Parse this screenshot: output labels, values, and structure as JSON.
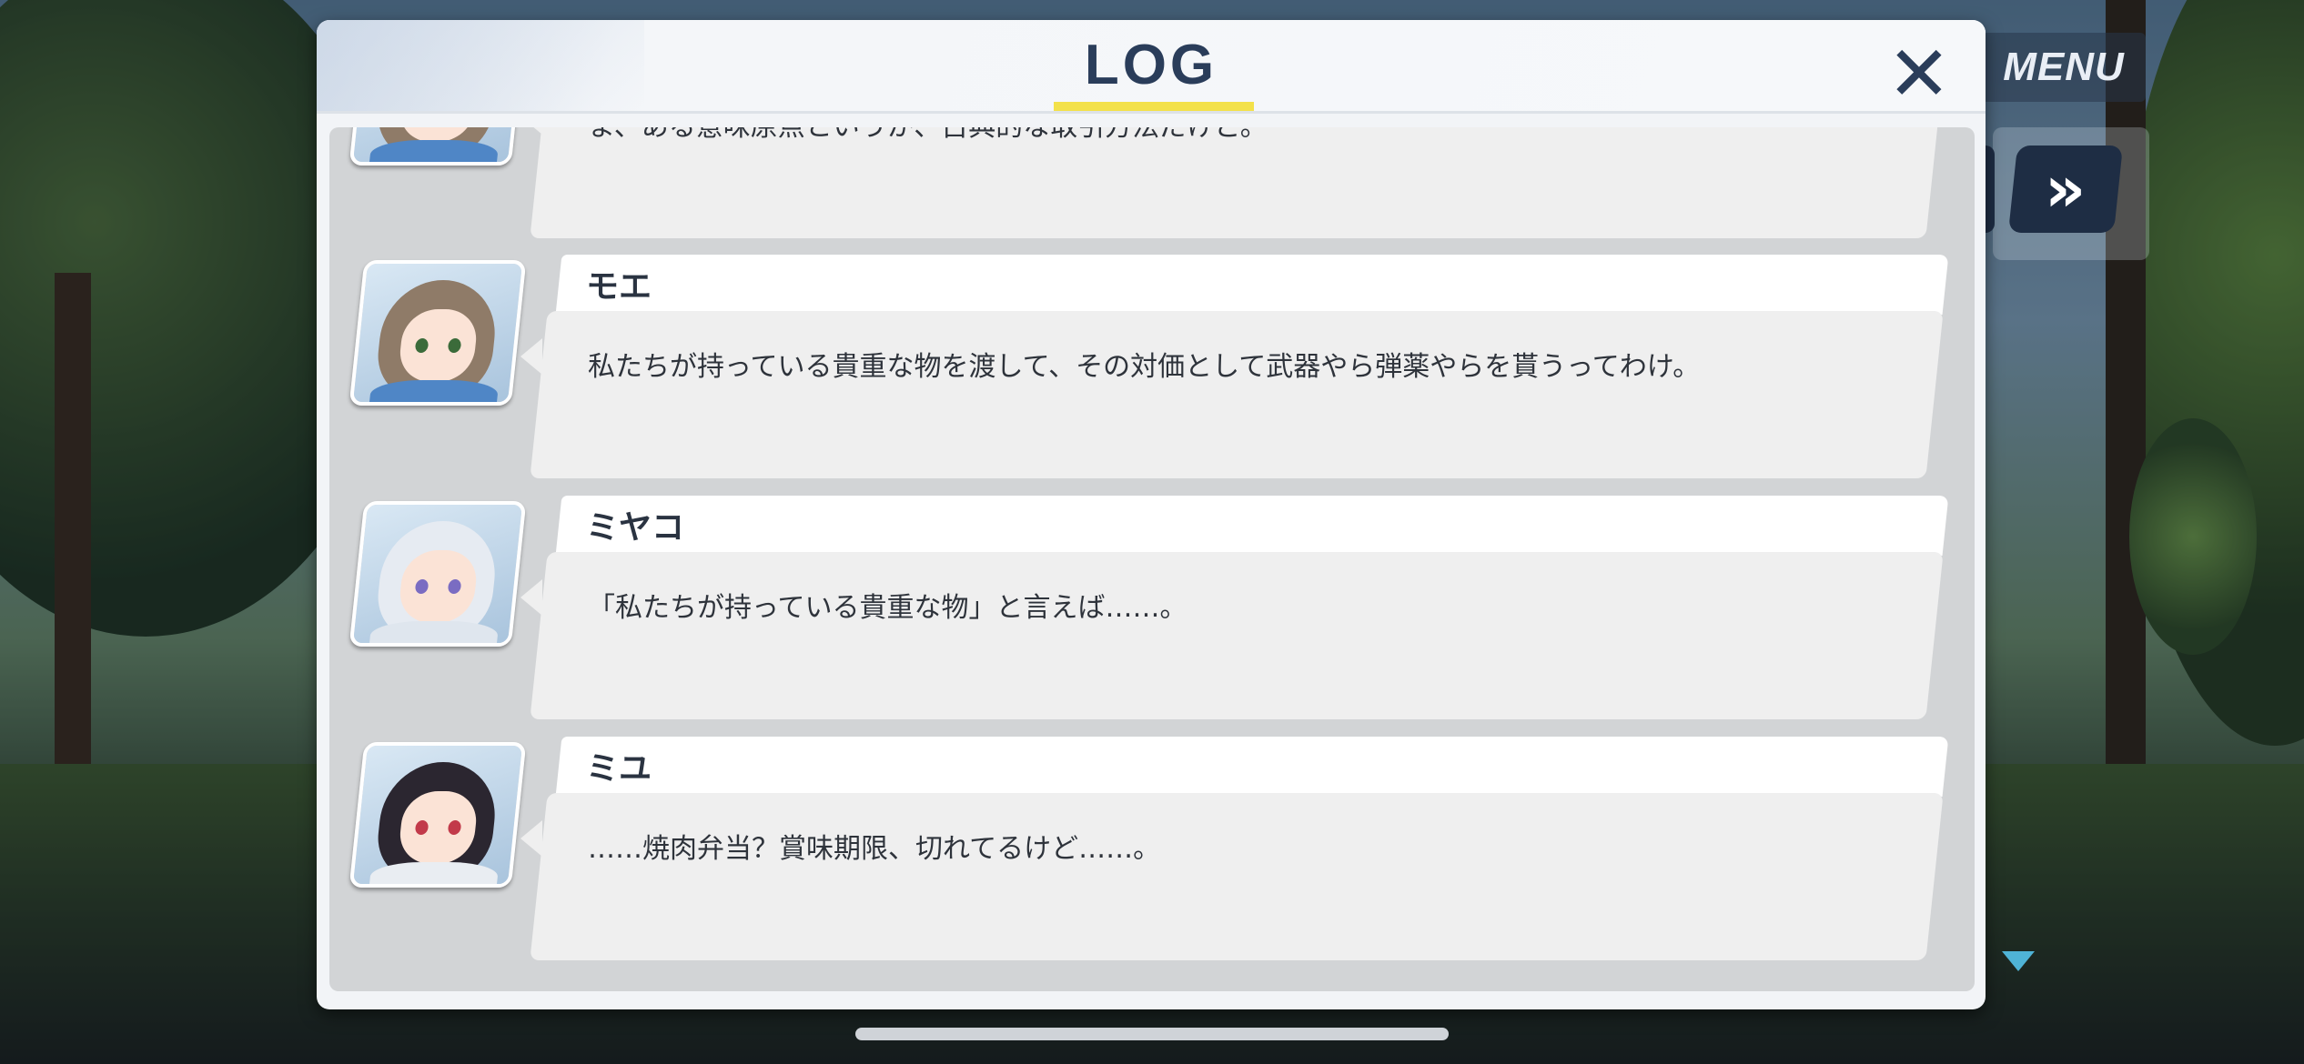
{
  "menu": {
    "label": "MENU"
  },
  "controls": {
    "fast_forward": "»"
  },
  "log": {
    "title": "LOG",
    "close_symbol": "✕",
    "entries": [
      {
        "name": "",
        "text": "ま、ある意味原点というか、古典的な取引方法だけど。",
        "hair": "#8f7b68",
        "eye": "#3b6b3a",
        "cloth": "#4f86c6"
      },
      {
        "name": "モエ",
        "text": "私たちが持っている貴重な物を渡して、その対価として武器やら弾薬やらを貰うってわけ。",
        "hair": "#8f7b68",
        "eye": "#3b6b3a",
        "cloth": "#4f86c6"
      },
      {
        "name": "ミヤコ",
        "text": "「私たちが持っている貴重な物」と言えば……。",
        "hair": "#e6ebf2",
        "eye": "#7a6cc2",
        "cloth": "#dfe6ee"
      },
      {
        "name": "ミユ",
        "text": "……焼肉弁当？賞味期限、切れてるけど……。",
        "hair": "#2b2630",
        "eye": "#c23a4a",
        "cloth": "#e9edf2"
      }
    ]
  }
}
